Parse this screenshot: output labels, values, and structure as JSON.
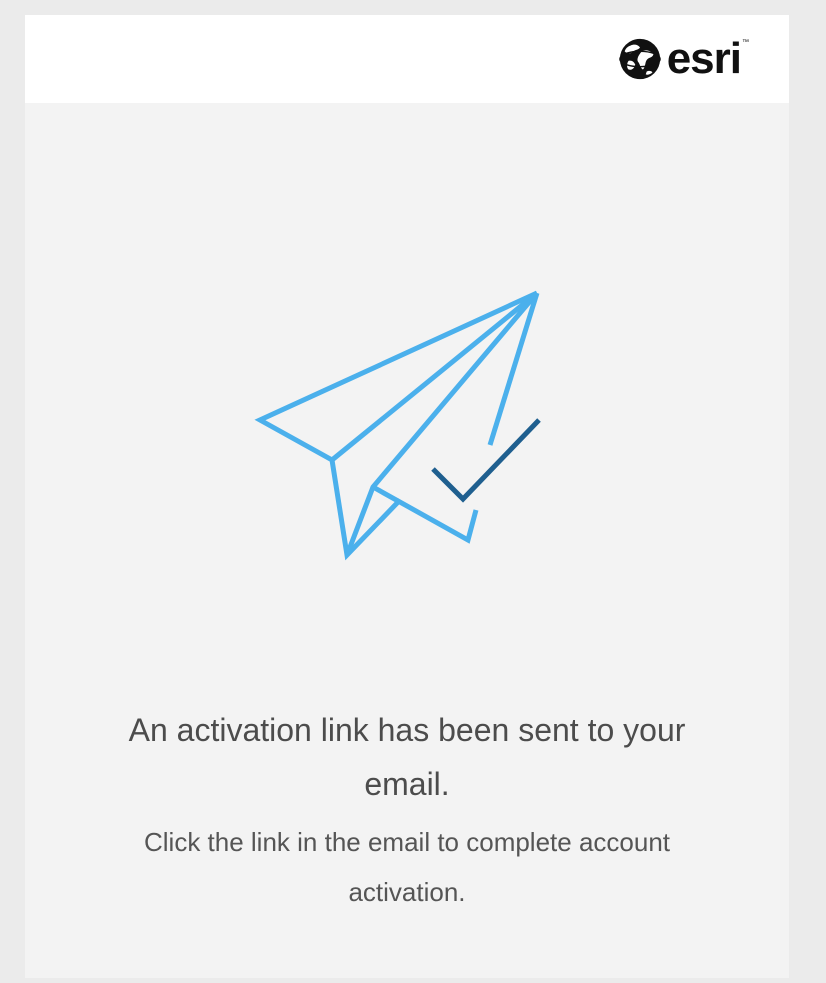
{
  "brand": {
    "logo_text": "esri",
    "trademark": "™",
    "logo_color": "#111111"
  },
  "illustration": {
    "icon": "paper-plane-check-icon",
    "plane_color": "#4bb0ec",
    "check_color": "#1f5f8f"
  },
  "message": {
    "title": "An activation link has been sent to your email.",
    "subtitle": "Click the link in the email to complete account activation."
  },
  "colors": {
    "page_background": "#ebebeb",
    "card_background": "#f3f3f3",
    "header_background": "#ffffff",
    "text": "#4c4c4c"
  }
}
